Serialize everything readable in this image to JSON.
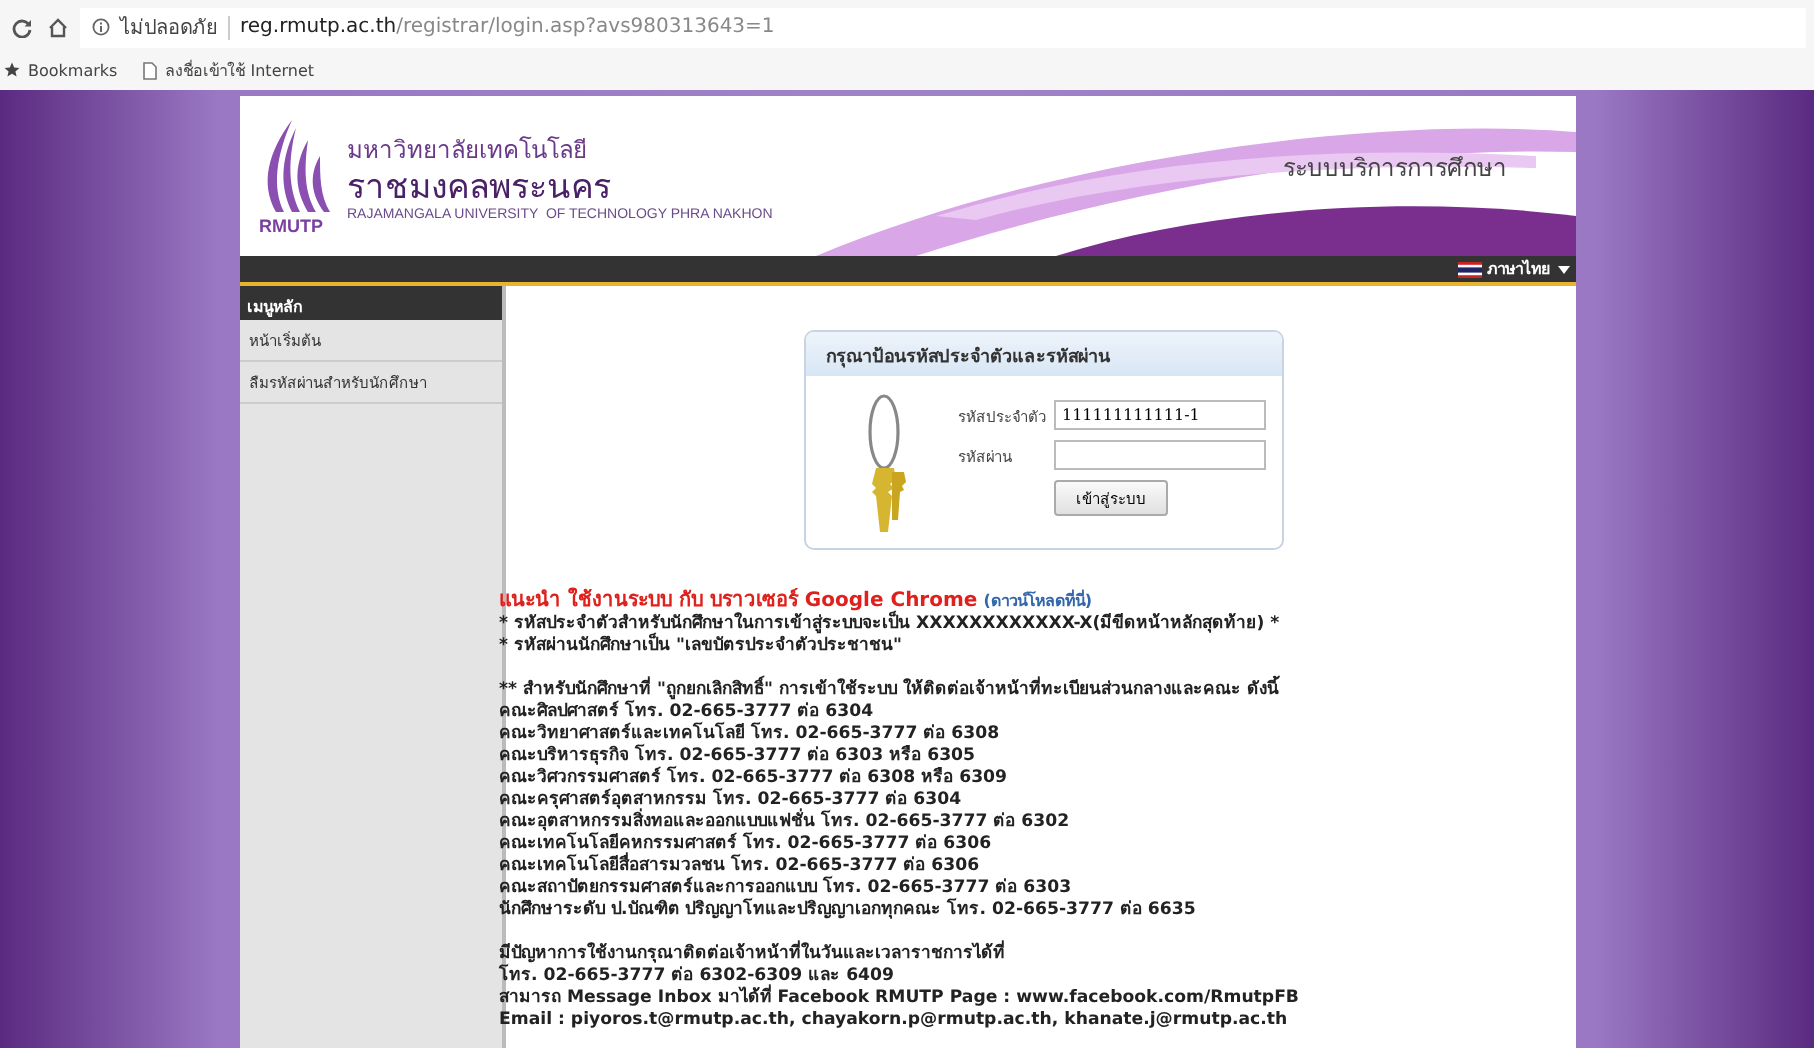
{
  "browser": {
    "security": "ไม่ปลอดภัย",
    "url_host": "reg.rmutp.ac.th",
    "url_path": "/registrar/login.asp?avs980313643=1",
    "bookmarks": [
      {
        "label": "Bookmarks",
        "kind": "star"
      },
      {
        "label": "ลงชื่อเข้าใช้ Internet",
        "kind": "page"
      }
    ]
  },
  "header": {
    "logo_text": "RMUTP",
    "name_line_1": "มหาวิทยาลัยเทคโนโลยี",
    "name_line_2": "ราชมงคลพระนคร",
    "name_english": "RAJAMANGALA UNIVERSITY  OF TECHNOLOGY PHRA NAKHON",
    "system_name": "ระบบบริการการศึกษา"
  },
  "language": "ภาษาไทย",
  "sidebar": {
    "title": "เมนูหลัก",
    "items": [
      {
        "label": "หน้าเริ่มต้น"
      },
      {
        "label": "ลืมรหัสผ่านสำหรับนักศึกษา"
      }
    ]
  },
  "login": {
    "title": "กรุณาป้อนรหัสประจำตัวและรหัสผ่าน",
    "fields": [
      {
        "label": "รหัสประจำตัว",
        "value": "111111111111-1"
      },
      {
        "label": "รหัสผ่าน"
      }
    ],
    "button": "เข้าสู่ระบบ"
  },
  "notice": {
    "heading": "แนะนำ ใช้งานระบบ กับ บราวเซอร์ Google Chrome",
    "download_link": "(ดาวน์โหลดที่นี่)",
    "sections": [
      [
        "* รหัสประจำตัวสำหรับนักศึกษาในการเข้าสู่ระบบจะเป็น XXXXXXXXXXXX-X(มีขีดหน้าหลักสุดท้าย) *",
        "* รหัสผ่านนักศึกษาเป็น \"เลขบัตรประจำตัวประชาชน\""
      ],
      [
        "** สำหรับนักศึกษาที่ \"ถูกยกเลิกสิทธิ์\" การเข้าใช้ระบบ ให้ติดต่อเจ้าหน้าที่ทะเบียนส่วนกลางและคณะ ดังนี้",
        "คณะศิลปศาสตร์ โทร. 02-665-3777 ต่อ 6304",
        "คณะวิทยาศาสตร์และเทคโนโลยี โทร. 02-665-3777 ต่อ 6308",
        "คณะบริหารธุรกิจ โทร. 02-665-3777 ต่อ 6303 หรือ 6305",
        "คณะวิศวกรรมศาสตร์ โทร. 02-665-3777 ต่อ 6308 หรือ 6309",
        "คณะครุศาสตร์อุตสาหกรรม โทร. 02-665-3777 ต่อ 6304",
        "คณะอุตสาหกรรมสิ่งทอและออกแบบแฟชั่น โทร. 02-665-3777 ต่อ 6302",
        "คณะเทคโนโลยีคหกรรมศาสตร์ โทร. 02-665-3777 ต่อ 6306",
        "คณะเทคโนโลยีสื่อสารมวลชน โทร. 02-665-3777 ต่อ 6306",
        "คณะสถาปัตยกรรมศาสตร์และการออกแบบ โทร. 02-665-3777 ต่อ 6303",
        "นักศึกษาระดับ ป.บัณฑิต ปริญญาโทและปริญญาเอกทุกคณะ โทร. 02-665-3777 ต่อ 6635"
      ],
      [
        "มีปัญหาการใช้งานกรุณาติดต่อเจ้าหน้าที่ในวันและเวลาราชการได้ที่",
        "โทร. 02-665-3777 ต่อ 6302-6309 และ 6409",
        "สามารถ Message Inbox มาได้ที่ Facebook RMUTP Page : www.facebook.com/RmutpFB",
        "Email : piyoros.t@rmutp.ac.th, chayakorn.p@rmutp.ac.th, khanate.j@rmutp.ac.th"
      ]
    ]
  }
}
